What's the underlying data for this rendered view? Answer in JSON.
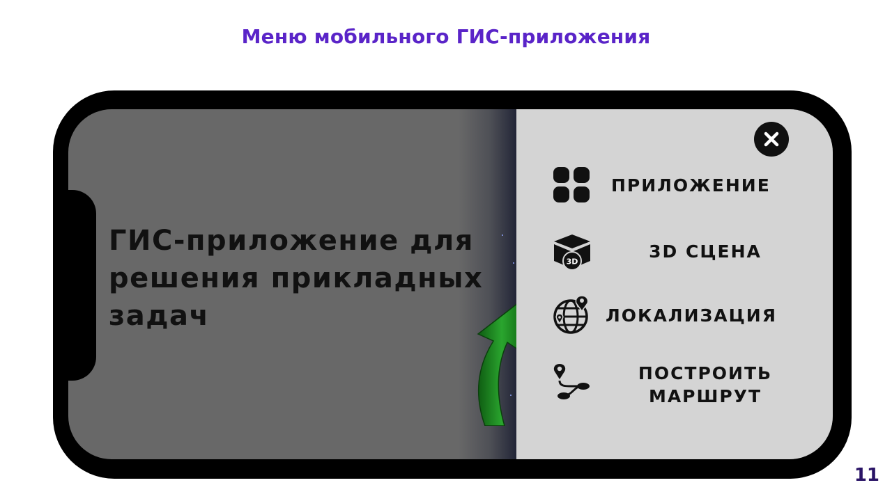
{
  "slide": {
    "title": "Меню мобильного ГИС-приложения",
    "page_number": "11"
  },
  "app": {
    "headline": "ГИС-приложение для решения прикладных задач"
  },
  "menu": {
    "close_icon": "close-icon",
    "items": [
      {
        "label": "ПРИЛОЖЕНИЕ",
        "icon": "apps-grid-icon"
      },
      {
        "label": "3D СЦЕНА",
        "icon": "3d-cube-icon"
      },
      {
        "label": "ЛОКАЛИЗАЦИЯ",
        "icon": "globe-pin-icon"
      },
      {
        "label": "ПОСТРОИТЬ\nМАРШРУТ",
        "icon": "route-icon"
      }
    ]
  },
  "colors": {
    "title": "#5a24c8",
    "page_number": "#2a1466",
    "screen_background": "#686868",
    "menu_background": "#d4d4d4",
    "arrow": "#1f8a22"
  }
}
